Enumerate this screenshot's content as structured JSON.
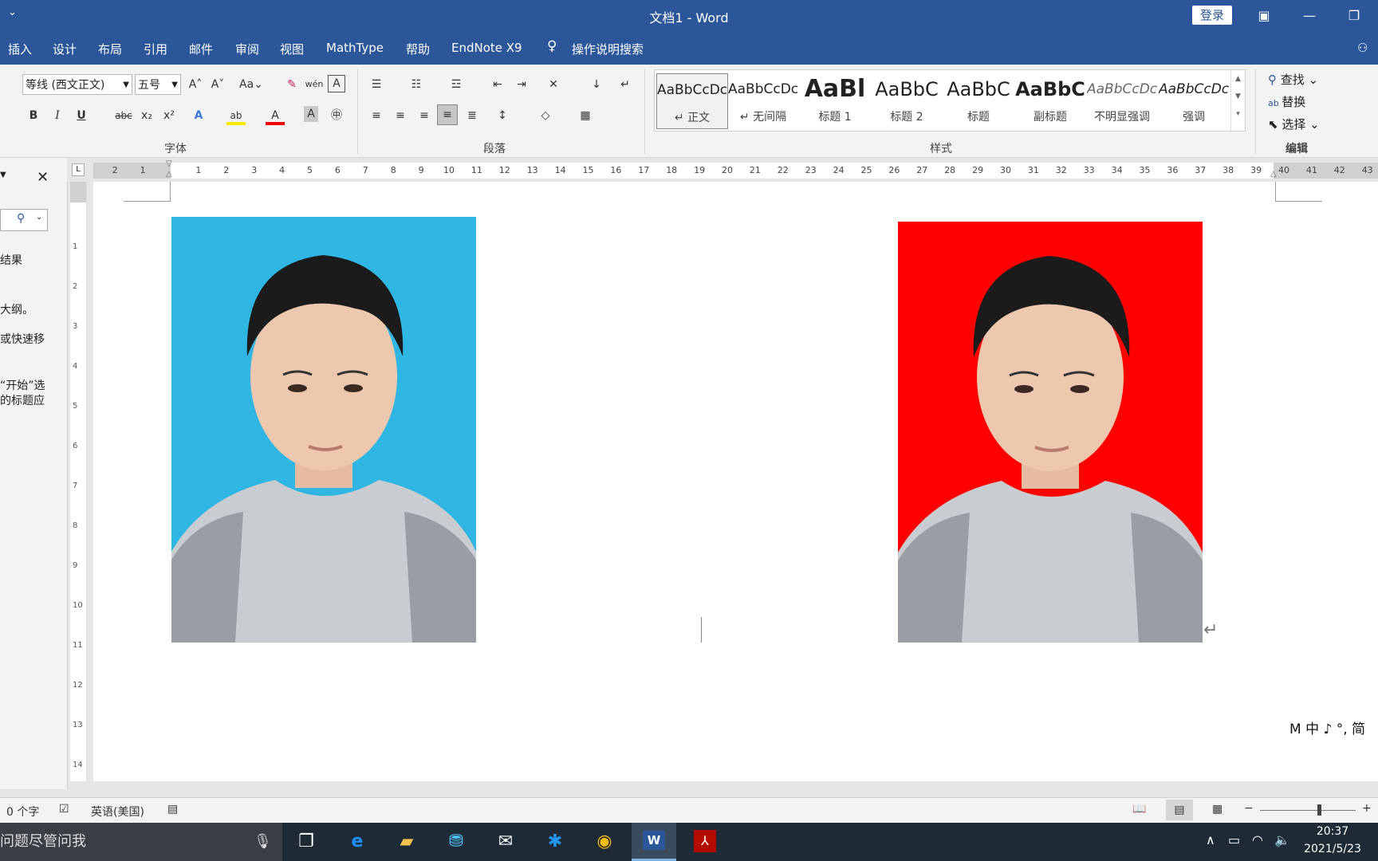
{
  "titlebar": {
    "title": "文档1 - Word",
    "login": "登录"
  },
  "tabs": [
    "插入",
    "设计",
    "布局",
    "引用",
    "邮件",
    "审阅",
    "视图",
    "MathType",
    "帮助",
    "EndNote X9"
  ],
  "tellme": "操作说明搜索",
  "ribbon": {
    "font_name": "等线 (西文正文)",
    "font_size": "五号",
    "groups": {
      "font": "字体",
      "paragraph": "段落",
      "styles": "样式",
      "editing": "编辑"
    },
    "styles": [
      {
        "sample": "AaBbCcDc",
        "name": "↵ 正文"
      },
      {
        "sample": "AaBbCcDc",
        "name": "↵ 无间隔"
      },
      {
        "sample": "AaBl",
        "name": "标题 1"
      },
      {
        "sample": "AaBbC",
        "name": "标题 2"
      },
      {
        "sample": "AaBbC",
        "name": "标题"
      },
      {
        "sample": "AaBbC",
        "name": "副标题"
      },
      {
        "sample": "AaBbCcDc",
        "name": "不明显强调"
      },
      {
        "sample": "AaBbCcDc",
        "name": "强调"
      }
    ],
    "editing": {
      "find": "查找",
      "replace": "替换",
      "select": "选择"
    }
  },
  "navpane": {
    "lines": [
      "结果",
      "大纲。",
      "或快速移",
      "“开始”选",
      "的标题应"
    ]
  },
  "ruler": {
    "numbers": [
      "2",
      "1",
      "1",
      "2",
      "3",
      "4",
      "5",
      "6",
      "7",
      "8",
      "9",
      "10",
      "11",
      "12",
      "13",
      "14",
      "15",
      "16",
      "17",
      "18",
      "19",
      "20",
      "21",
      "22",
      "23",
      "24",
      "25",
      "26",
      "27",
      "28",
      "29",
      "30",
      "31",
      "32",
      "33",
      "34",
      "35",
      "36",
      "37",
      "38",
      "39",
      "40",
      "41",
      "42",
      "43"
    ]
  },
  "ime": "M 中 ♪ °, 简",
  "statusbar": {
    "words": "0 个字",
    "language": "英语(美国)"
  },
  "taskbar": {
    "search_placeholder": "问题尽管问我",
    "time": "20:37",
    "date": "2021/5/23"
  },
  "colors": {
    "photo1_bg": "#30b6e2",
    "photo2_bg": "#ff0000",
    "accent": "#2b579a"
  }
}
